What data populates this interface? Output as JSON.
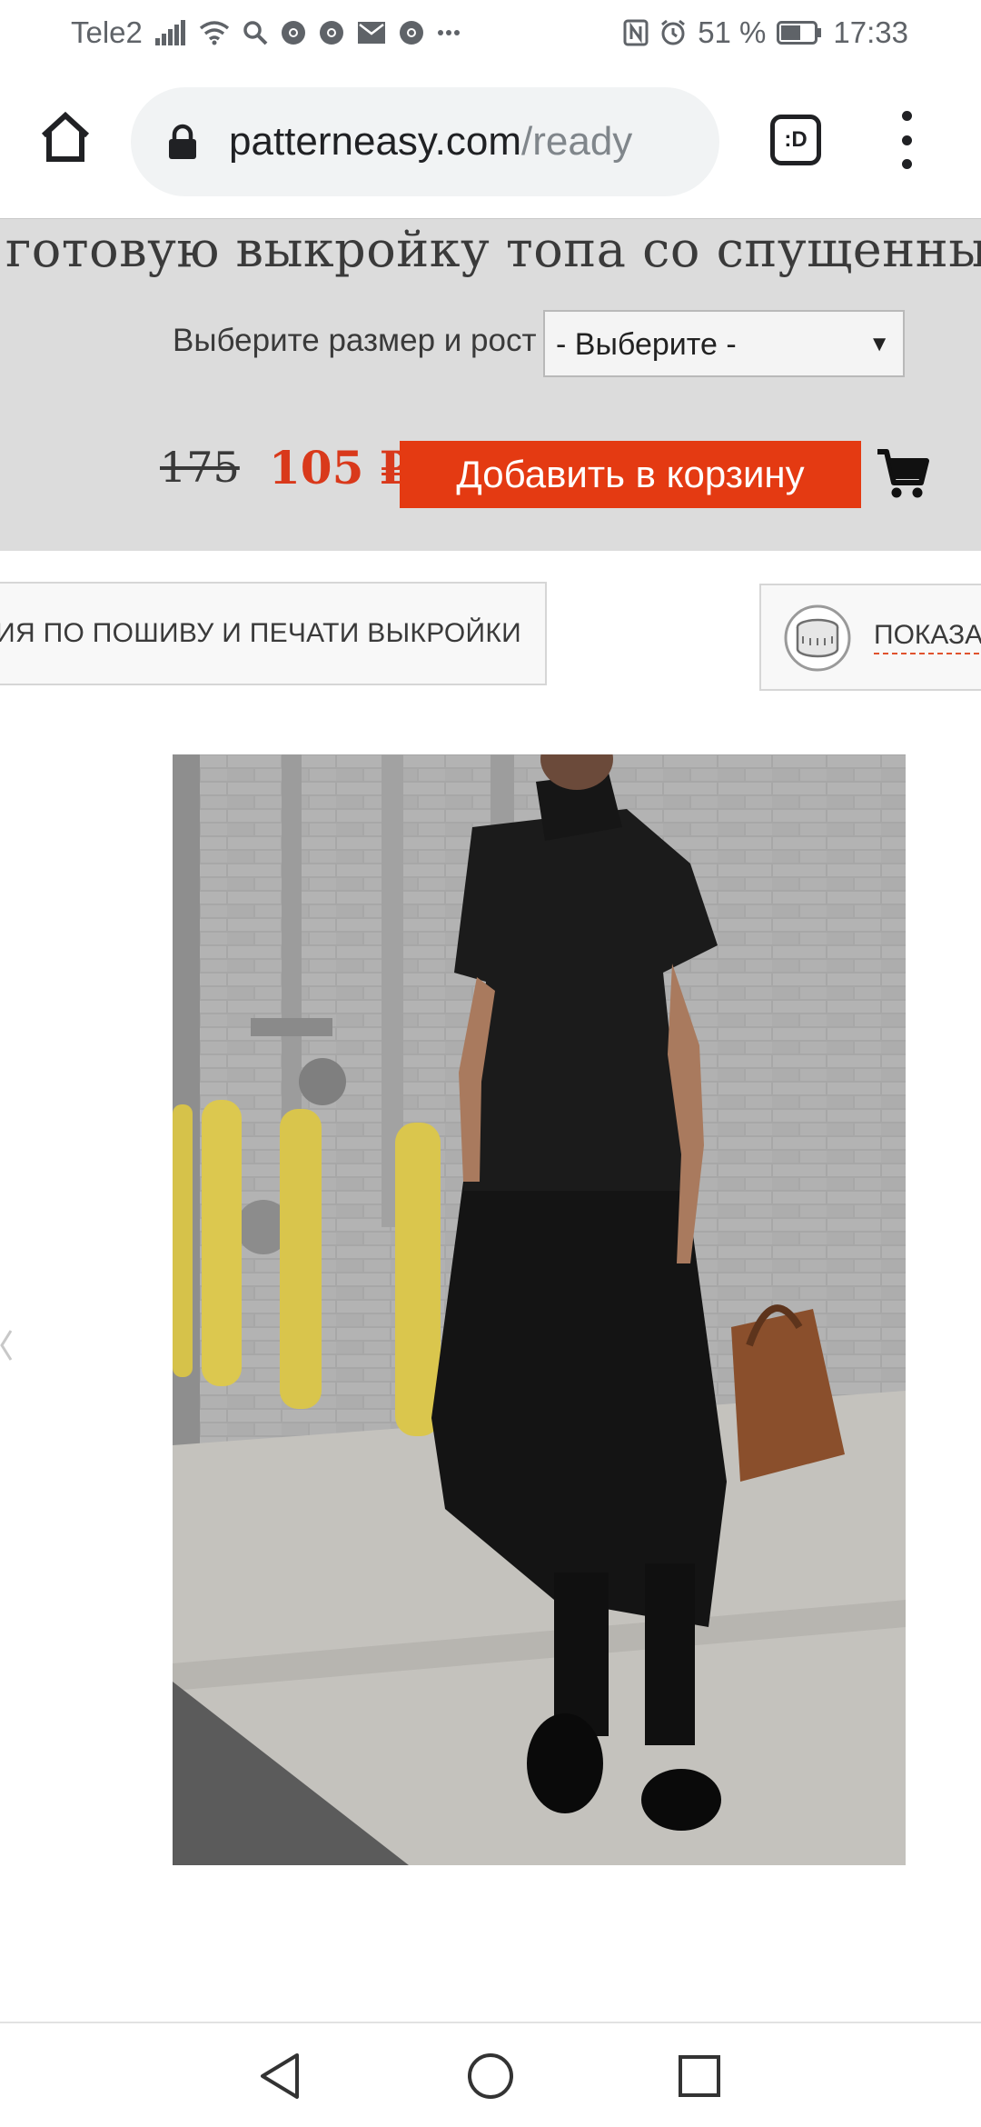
{
  "status_bar": {
    "carrier": "Tele2",
    "battery": "51 %",
    "time": "17:33",
    "icons_left": [
      "signal-icon",
      "wifi-icon",
      "search-icon",
      "chrome-icon",
      "chrome-icon",
      "mail-icon",
      "chrome-icon",
      "more-icon"
    ],
    "icons_right": [
      "nfc-icon",
      "alarm-icon",
      "battery-icon"
    ]
  },
  "browser": {
    "url_domain": "patterneasy.com",
    "url_path": "/ready",
    "tab_switcher_label": ":D",
    "icons": [
      "home-icon",
      "lock-icon",
      "tab-switcher-icon",
      "overflow-menu-icon"
    ]
  },
  "product": {
    "title": "готовую выкройку топа со спущенным рукавом",
    "size_label": "Выберите размер и рост",
    "size_select_value": "- Выберите -",
    "old_price": "175",
    "new_price": "105 ₽",
    "add_to_cart_label": "Добавить в корзину"
  },
  "info_buttons": {
    "left_label": "ДИЯ ПО ПОШИВУ И ПЕЧАТИ ВЫКРОЙКИ",
    "right_label": "ПОКАЗАТЬ"
  },
  "colors": {
    "accent": "#e43a12",
    "price_red": "#d9391b",
    "panel_gray": "#dcdcdc"
  }
}
